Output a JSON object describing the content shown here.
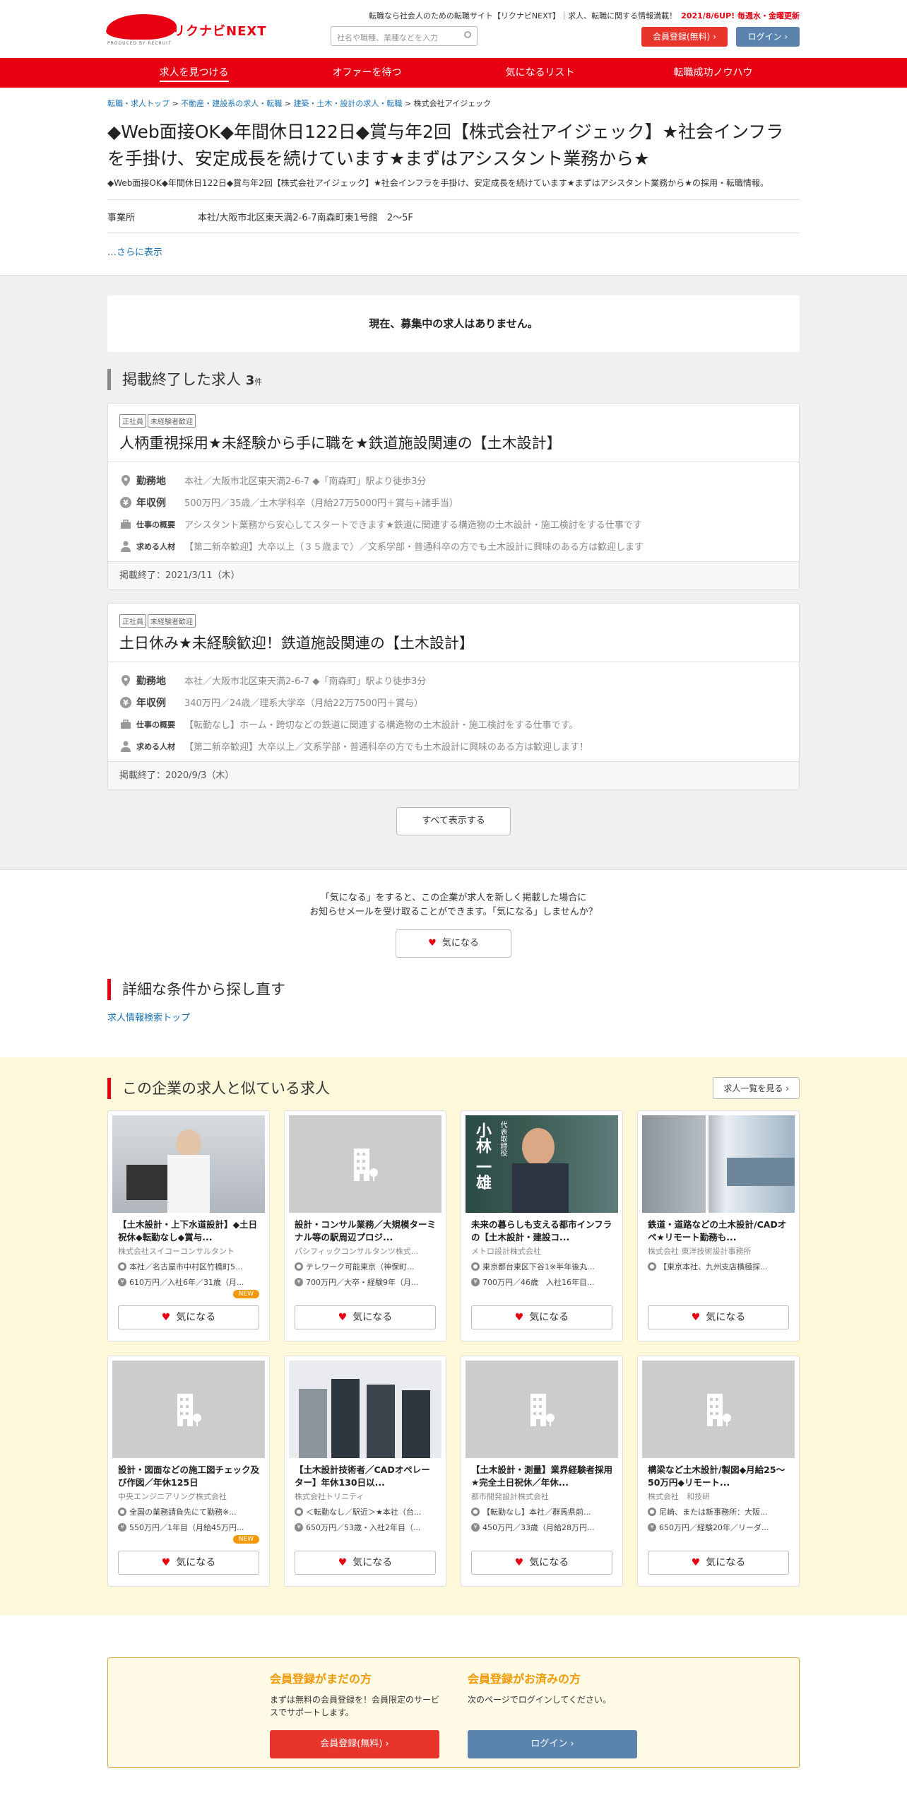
{
  "header": {
    "logo_text": "リクナビ",
    "logo_next": "NEXT",
    "logo_sub": "PRODUCED BY RECRUIT",
    "tagline": "転職なら社会人のための転職サイト【リクナビNEXT】｜求人、転職に関する情報満載！",
    "update": "2021/8/6UP! 毎週水・金曜更新",
    "search_placeholder": "社名や職種、業種などを入力",
    "register_label": "会員登録(無料)",
    "login_label": "ログイン"
  },
  "nav": {
    "items": [
      "求人を見つける",
      "オファーを待つ",
      "気になるリスト",
      "転職成功ノウハウ"
    ]
  },
  "company": {
    "breadcrumb": [
      "転職・求人トップ",
      "不動産・建設系の求人・転職",
      "建築・土木・設計の求人・転職",
      "株式会社アイジェック"
    ],
    "title": "◆Web面接OK◆年間休日122日◆賞与年2回【株式会社アイジェック】★社会インフラを手掛け、安定成長を続けています★まずはアシスタント業務から★",
    "desc": "◆Web面接OK◆年間休日122日◆賞与年2回【株式会社アイジェック】★社会インフラを手掛け、安定成長を続けています★まずはアシスタント業務から★の採用・転職情報。",
    "office_label": "事業所",
    "office_value": "本社/大阪市北区東天満2-6-7南森町東1号館　2～5F",
    "more": "…さらに表示"
  },
  "notice": "現在、募集中の求人はありません。",
  "ended": {
    "heading": "掲載終了した求人",
    "count": "3",
    "unit": "件",
    "labels": {
      "loc": "勤務地",
      "salary": "年収例",
      "summary": "仕事の概要",
      "seek": "求める人材"
    },
    "jobs": [
      {
        "tags": [
          "正社員",
          "未経験者歓迎"
        ],
        "title": "人柄重視採用★未経験から手に職を★鉄道施設関連の【土木設計】",
        "loc": "本社／大阪市北区東天満2-6-7 ◆「南森町」駅より徒歩3分",
        "salary": "500万円／35歳／土木学科卒（月給27万5000円＋賞与+諸手当）",
        "summary": "アシスタント業務から安心してスタートできます★鉄道に関連する構造物の土木設計・施工検討をする仕事です",
        "seek": "【第二新卒歓迎】大卒以上（３５歳まで）／文系学部・普通科卒の方でも土木設計に興味のある方は歓迎します",
        "end": "掲載終了：2021/3/11（木）"
      },
      {
        "tags": [
          "正社員",
          "未経験者歓迎"
        ],
        "title": "土日休み★未経験歓迎！鉄道施設関連の【土木設計】",
        "loc": "本社／大阪市北区東天満2-6-7 ◆「南森町」駅より徒歩3分",
        "salary": "340万円／24歳／理系大学卒（月給22万7500円＋賞与）",
        "summary": "【転勤なし】ホーム・跨切などの鉄道に関連する構造物の土木設計・施工検討をする仕事です。",
        "seek": "【第二新卒歓迎】大卒以上／文系学部・普通科卒の方でも土木設計に興味のある方は歓迎します！",
        "end": "掲載終了：2020/9/3（木）"
      }
    ],
    "show_all": "すべて表示する"
  },
  "favorite": {
    "line1": "「気になる」をすると、この企業が求人を新しく掲載した場合に",
    "line2": "お知らせメールを受け取ることができます。「気になる」しませんか？",
    "button": "気になる"
  },
  "search_again": {
    "heading": "詳細な条件から探し直す",
    "link": "求人情報検索トップ"
  },
  "similar": {
    "heading": "この企業の求人と似ている求人",
    "list_link": "求人一覧を見る",
    "fav_label": "気になる",
    "new_label": "NEW",
    "cards": [
      {
        "title": "【土木設計・上下水道設計】◆土日祝休◆転勤なし◆賞与...",
        "company": "株式会社スイコーコンサルタント",
        "loc": "本社／名古屋市中村区竹橋町5...",
        "salary": "610万円／入社6年／31歳（月...",
        "new": true,
        "img": "photo1"
      },
      {
        "title": "設計・コンサル業務／大規模ターミナル等の駅周辺プロジ...",
        "company": "パシフィックコンサルタンツ株式...",
        "loc": "テレワーク可能東京（神保町...",
        "salary": "700万円／大卒・経験9年（月...",
        "new": false,
        "img": "bldg"
      },
      {
        "title": "未来の暮らしも支える都市インフラの【土木設計・建設コ...",
        "company": "メトロ設計株式会社",
        "loc": "東京都台東区下谷1※半年後丸...",
        "salary": "700万円／46歳　入社16年目...",
        "new": false,
        "img": "photo3",
        "img_text": "代表取締役",
        "img_name": "小林 一雄"
      },
      {
        "title": "鉄道・道路などの土木設計/CADオペ★リモート勤務も...",
        "company": "株式会社 東洋技術設計事務所",
        "loc": "【東京本社、九州支店横極採...",
        "salary": "",
        "new": false,
        "img": "photo4"
      },
      {
        "title": "設計・図面などの施工図チェック及び作図／年休125日",
        "company": "中央エンジニアリング株式会社",
        "loc": "全国の業務請負先にて勤務※...",
        "salary": "550万円／1年目（月給45万円...",
        "new": true,
        "img": "bldg"
      },
      {
        "title": "【土木設計技術者／CADオペレーター】年休130日以...",
        "company": "株式会社トリニティ",
        "loc": "＜転勤なし／駅近＞★本社（台...",
        "salary": "650万円／53歳・入社2年目（...",
        "new": false,
        "img": "photo6"
      },
      {
        "title": "【土木設計・測量】業界経験者採用★完全土日祝休／年休...",
        "company": "都市開発設計株式会社",
        "loc": "【転勤なし】本社／群馬県前...",
        "salary": "450万円／33歳（月給28万円...",
        "new": false,
        "img": "bldg"
      },
      {
        "title": "構梁など土木設計/製図◆月給25～50万円◆リモート...",
        "company": "株式会社　和技研",
        "loc": "尼崎、または新事務所：大阪...",
        "salary": "650万円／経験20年／リーダ...",
        "new": false,
        "img": "bldg"
      }
    ]
  },
  "register": {
    "not_member_heading": "会員登録がまだの方",
    "not_member_text": "まずは無料の会員登録を！会員限定のサービスでサポートします。",
    "not_member_button": "会員登録(無料)",
    "member_heading": "会員登録がお済みの方",
    "member_text": "次のページでログインしてください。",
    "member_button": "ログイン"
  },
  "colors": {
    "brand": "#e60012",
    "login": "#5a83ad",
    "accent": "#f39800"
  }
}
